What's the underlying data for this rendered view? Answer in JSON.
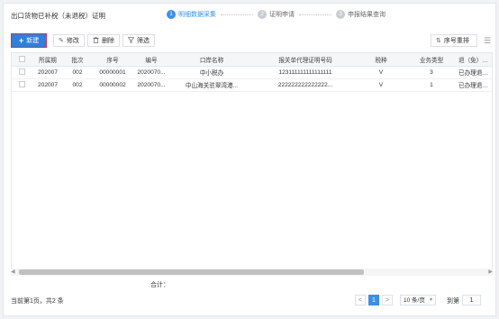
{
  "header": {
    "title": "出口货物已补税（未退税）证明",
    "steps": [
      {
        "num": "1",
        "label": "明细数据采集"
      },
      {
        "num": "2",
        "label": "证明申请"
      },
      {
        "num": "3",
        "label": "申报结果查询"
      }
    ]
  },
  "toolbar": {
    "new_label": "新建",
    "edit_label": "修改",
    "delete_label": "删除",
    "filter_label": "筛选",
    "sort_label": "序号重排"
  },
  "table": {
    "columns": [
      "",
      "所属期",
      "批次",
      "序号",
      "编号",
      "口岸名称",
      "报关单代理证明号码",
      "税种",
      "业务类型",
      "退（免）税业"
    ],
    "rows": [
      [
        "",
        "202007",
        "002",
        "00000001",
        "2020070...",
        "中小税办",
        "123111111111111111",
        "V",
        "3",
        "已办理退（免"
      ],
      [
        "",
        "202007",
        "002",
        "00000002",
        "2020070...",
        "中山海关驻翠湾港...",
        "222222222222222...",
        "V",
        "1",
        "已办理退（免"
      ]
    ],
    "total_label": "合计："
  },
  "footer": {
    "page_info": "当前第1页，共2 条",
    "prev": "<",
    "current_page": "1",
    "next": ">",
    "page_size": "10 条/页",
    "goto_label": "到第",
    "goto_value": "1"
  },
  "colors": {
    "accent": "#3b8fe8",
    "primary_button": "#2f80dc",
    "highlight_border": "#d9303b"
  }
}
